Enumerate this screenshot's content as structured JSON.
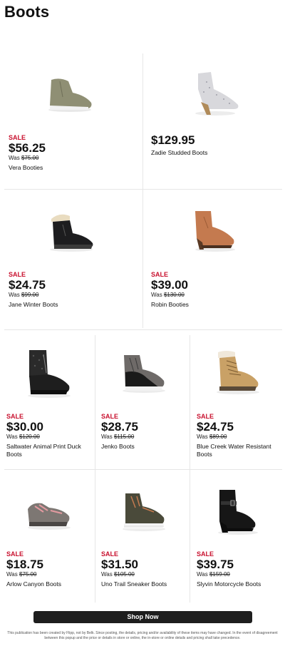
{
  "page": {
    "title": "Boots"
  },
  "products": [
    {
      "sale": "SALE",
      "price": "$56.25",
      "was_label": "Was",
      "was_price": "$75.00",
      "name": "Vera Booties",
      "icon": "ankle-bootie-olive"
    },
    {
      "sale": "",
      "price": "$129.95",
      "was_label": "",
      "was_price": "",
      "name": "Zadie Studded Boots",
      "icon": "studded-western-bootie-white"
    },
    {
      "sale": "SALE",
      "price": "$24.75",
      "was_label": "Was",
      "was_price": "$99.00",
      "name": "Jane Winter Boots",
      "icon": "winter-boot-black"
    },
    {
      "sale": "SALE",
      "price": "$39.00",
      "was_label": "Was",
      "was_price": "$130.00",
      "name": "Robin Booties",
      "icon": "heeled-bootie-brown"
    },
    {
      "sale": "SALE",
      "price": "$30.00",
      "was_label": "Was",
      "was_price": "$120.00",
      "name": "Saltwater Animal Print Duck Boots",
      "icon": "duck-boot-black"
    },
    {
      "sale": "SALE",
      "price": "$28.75",
      "was_label": "Was",
      "was_price": "$115.00",
      "name": "Jenko Boots",
      "icon": "hiking-boot-grey"
    },
    {
      "sale": "SALE",
      "price": "$24.75",
      "was_label": "Was",
      "was_price": "$89.00",
      "name": "Blue Creek Water Resistant Boots",
      "icon": "lace-up-boot-tan"
    },
    {
      "sale": "SALE",
      "price": "$18.75",
      "was_label": "Was",
      "was_price": "$75.00",
      "name": "Arlow Canyon Boots",
      "icon": "hiking-shoe-grey-pink"
    },
    {
      "sale": "SALE",
      "price": "$31.50",
      "was_label": "Was",
      "was_price": "$105.00",
      "name": "Uno Trail Sneaker Boots",
      "icon": "trail-sneaker-olive"
    },
    {
      "sale": "SALE",
      "price": "$39.75",
      "was_label": "Was",
      "was_price": "$159.00",
      "name": "Slyvin Motorcycle Boots",
      "icon": "moto-boot-black"
    }
  ],
  "shop_now_label": "Shop Now",
  "disclaimer": "This publication has been created by Flipp, not by Belk. Since posting, the details, pricing and/or availability of these items may have changed. In the event of disagreement between this popup and the price or details in store or online, the in-store or online details and pricing shall take precedence.",
  "colors": {
    "sale": "#c8102e",
    "button": "#1e1e1e"
  }
}
